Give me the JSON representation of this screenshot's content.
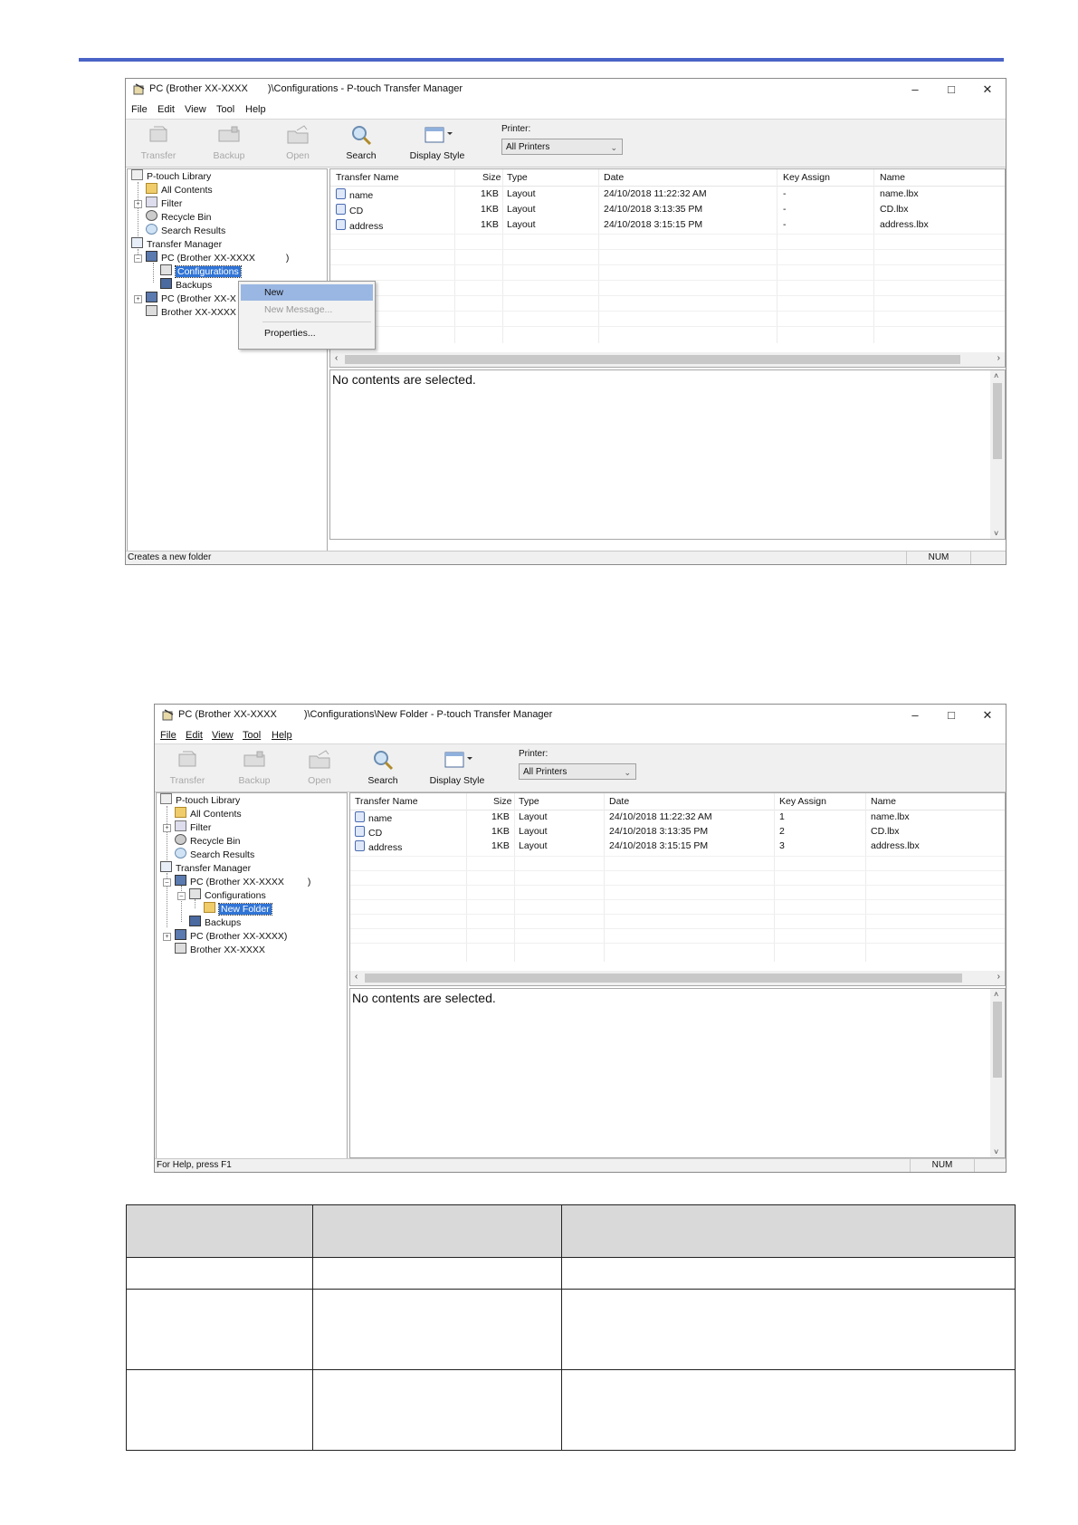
{
  "screens": [
    {
      "title_left": "PC (Brother XX-XXXX",
      "title_right": ")\\Configurations - P-touch Transfer Manager",
      "menu": [
        "File",
        "Edit",
        "View",
        "Tool",
        "Help"
      ],
      "toolbar": {
        "transfer": "Transfer",
        "backup": "Backup",
        "open": "Open",
        "search": "Search",
        "display_style": "Display Style"
      },
      "printer_label": "Printer:",
      "printer_value": "All Printers",
      "tree": {
        "library": "P-touch Library",
        "all_contents": "All Contents",
        "filter": "Filter",
        "recycle_bin": "Recycle Bin",
        "search_results": "Search Results",
        "transfer_manager": "Transfer Manager",
        "pc_main": "PC (Brother XX-XXXX",
        "pc_main_close": ")",
        "configurations": "Configurations",
        "backups": "Backups",
        "pc_second": "PC (Brother XX-X",
        "brother": "Brother XX-XXXX"
      },
      "context_menu": {
        "new": "New",
        "new_message": "New Message...",
        "properties": "Properties..."
      },
      "status_left": "Creates a new folder",
      "status_num": "NUM"
    },
    {
      "title_left": "PC (Brother XX-XXXX",
      "title_right": ")\\Configurations\\New Folder - P-touch Transfer Manager",
      "menu": [
        "File",
        "Edit",
        "View",
        "Tool",
        "Help"
      ],
      "toolbar": {
        "transfer": "Transfer",
        "backup": "Backup",
        "open": "Open",
        "search": "Search",
        "display_style": "Display Style"
      },
      "printer_label": "Printer:",
      "printer_value": "All Printers",
      "tree": {
        "library": "P-touch Library",
        "all_contents": "All Contents",
        "filter": "Filter",
        "recycle_bin": "Recycle Bin",
        "search_results": "Search Results",
        "transfer_manager": "Transfer Manager",
        "pc_main": "PC (Brother XX-XXXX",
        "pc_main_close": ")",
        "configurations": "Configurations",
        "new_folder": "New Folder",
        "backups": "Backups",
        "pc_second": "PC (Brother XX-XXXX)",
        "brother": "Brother XX-XXXX"
      },
      "status_left": "For Help, press F1",
      "status_num": "NUM"
    }
  ],
  "list_headers": {
    "transfer_name": "Transfer Name",
    "size": "Size",
    "type": "Type",
    "date": "Date",
    "key_assign": "Key Assign",
    "name": "Name"
  },
  "files_1": [
    {
      "transfer_name": "name",
      "size": "1KB",
      "type": "Layout",
      "date": "24/10/2018 11:22:32 AM",
      "key_assign": "-",
      "name": "name.lbx"
    },
    {
      "transfer_name": "CD",
      "size": "1KB",
      "type": "Layout",
      "date": "24/10/2018 3:13:35 PM",
      "key_assign": "-",
      "name": "CD.lbx"
    },
    {
      "transfer_name": "address",
      "size": "1KB",
      "type": "Layout",
      "date": "24/10/2018 3:15:15 PM",
      "key_assign": "-",
      "name": "address.lbx"
    }
  ],
  "files_2": [
    {
      "transfer_name": "name",
      "size": "1KB",
      "type": "Layout",
      "date": "24/10/2018 11:22:32 AM",
      "key_assign": "1",
      "name": "name.lbx"
    },
    {
      "transfer_name": "CD",
      "size": "1KB",
      "type": "Layout",
      "date": "24/10/2018 3:13:35 PM",
      "key_assign": "2",
      "name": "CD.lbx"
    },
    {
      "transfer_name": "address",
      "size": "1KB",
      "type": "Layout",
      "date": "24/10/2018 3:15:15 PM",
      "key_assign": "3",
      "name": "address.lbx"
    }
  ],
  "preview_message": "No contents are selected.",
  "colors": {
    "accent_bar": "#4a63c6",
    "selection": "#3074d6",
    "menu_highlight": "#9ab7e3"
  }
}
